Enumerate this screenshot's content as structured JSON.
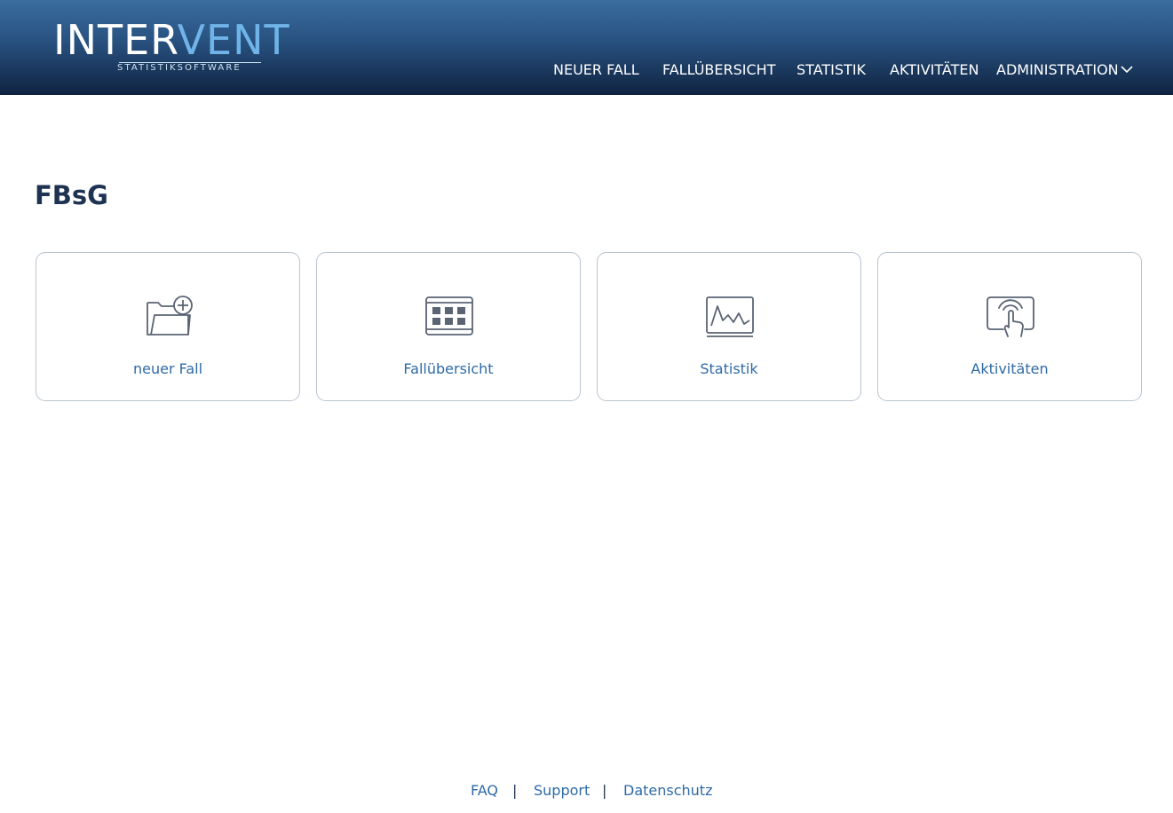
{
  "brand": {
    "logo_part1": "INTER",
    "logo_part2": "VENT",
    "logo_subtitle": "STATISTIKSOFTWARE"
  },
  "nav": {
    "items": [
      {
        "label": "NEUER FALL"
      },
      {
        "label": "FALLÜBERSICHT"
      },
      {
        "label": "STATISTIK"
      },
      {
        "label": "AKTIVITÄTEN"
      },
      {
        "label": "ADMINISTRATION"
      }
    ]
  },
  "main": {
    "title": "FBsG",
    "tiles": [
      {
        "label": "neuer Fall",
        "icon": "folder-add-icon"
      },
      {
        "label": "Fallübersicht",
        "icon": "table-grid-icon"
      },
      {
        "label": "Statistik",
        "icon": "line-chart-icon"
      },
      {
        "label": "Aktivitäten",
        "icon": "touch-hand-icon"
      }
    ]
  },
  "footer": {
    "links": [
      {
        "label": "FAQ"
      },
      {
        "label": "Support"
      },
      {
        "label": "Datenschutz"
      }
    ],
    "separator": "|"
  },
  "colors": {
    "header_top": "#3b6da0",
    "header_bottom": "#0f2340",
    "accent": "#2e6aa6",
    "title": "#1e3252",
    "tile_border": "#b9c4d1"
  }
}
